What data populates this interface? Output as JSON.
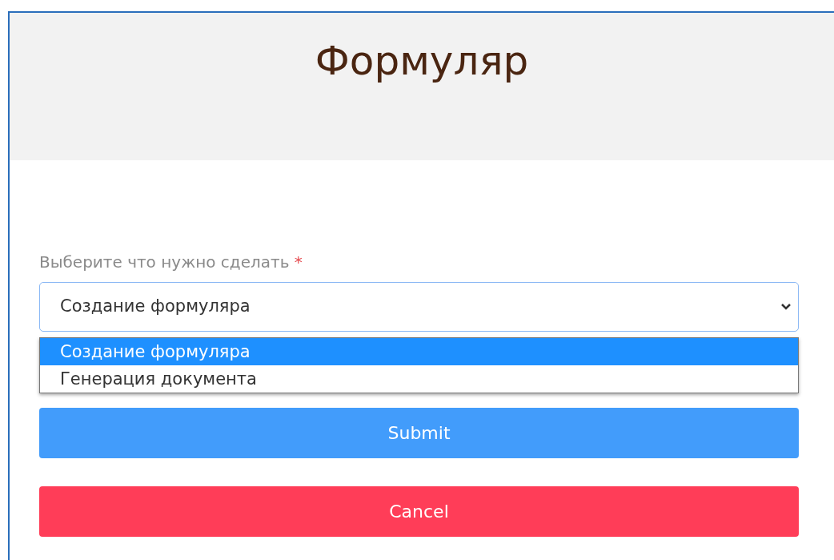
{
  "header": {
    "title": "Формуляр"
  },
  "field": {
    "label": "Выберите что нужно сделать",
    "required_mark": "*",
    "value": "Создание формуляра",
    "expanded": true,
    "options": [
      {
        "label": "Создание формуляра",
        "selected": true
      },
      {
        "label": "Генерация документа",
        "selected": false
      }
    ]
  },
  "buttons": [
    {
      "label": "Submit",
      "kind": "primary"
    },
    {
      "label": "Cancel",
      "kind": "danger"
    }
  ]
}
